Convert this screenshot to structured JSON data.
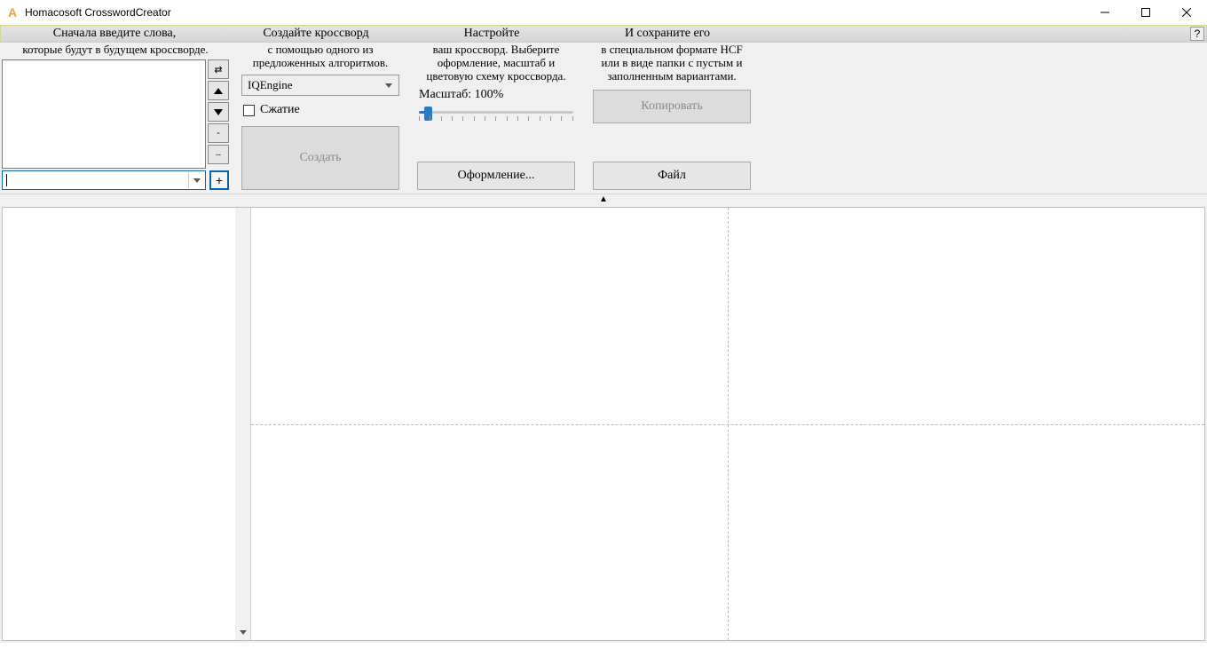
{
  "window": {
    "title": "Homacosoft CrosswordCreator"
  },
  "help_char": "?",
  "steps": {
    "s1_title": "Сначала введите слова,",
    "s1_sub": "которые будут в будущем кроссворде.",
    "s2_title": "Создайте кроссворд",
    "s2_sub": "с помощью одного из предложенных алгоритмов.",
    "s3_title": "Настройте",
    "s3_sub": "ваш кроссворд. Выберите оформление, масштаб и цветовую схему кроссворда.",
    "s4_title": "И сохраните его",
    "s4_sub": "в специальном формате HCF или в виде папки с пустым и заполненным вариантами."
  },
  "words": {
    "combo_value": "",
    "add_label": "+",
    "btn_swap": "⇄",
    "btn_up": "▲",
    "btn_down": "▼",
    "btn_minus": "-",
    "btn_dminus": "--"
  },
  "create": {
    "engine": "IQEngine",
    "compress_label": "Сжатие",
    "button": "Создать"
  },
  "config": {
    "scale_label": "Масштаб: 100%",
    "design_btn": "Оформление..."
  },
  "save": {
    "copy_btn": "Копировать",
    "file_btn": "Файл"
  },
  "collapse_glyph": "▲"
}
